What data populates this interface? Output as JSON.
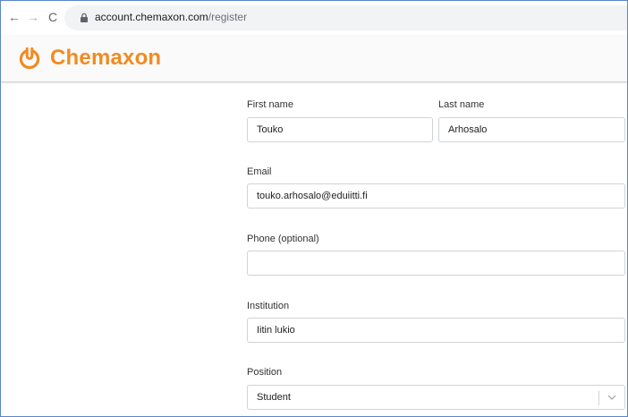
{
  "browser": {
    "url_host": "account.chemaxon.com",
    "url_path": "/register",
    "back_glyph": "←",
    "forward_glyph": "→",
    "reload_glyph": "C"
  },
  "header": {
    "logo_text": "Chemaxon",
    "brand_color": "#f28b21",
    "logo_icon": "chemaxon-logo-icon"
  },
  "form": {
    "first_name": {
      "label": "First name",
      "value": "Touko"
    },
    "last_name": {
      "label": "Last name",
      "value": "Arhosalo"
    },
    "email": {
      "label": "Email",
      "value": "touko.arhosalo@eduiitti.fi"
    },
    "phone": {
      "label": "Phone (optional)",
      "value": ""
    },
    "institution": {
      "label": "Institution",
      "value": "Iitin lukio"
    },
    "position": {
      "label": "Position",
      "value": "Student"
    }
  }
}
